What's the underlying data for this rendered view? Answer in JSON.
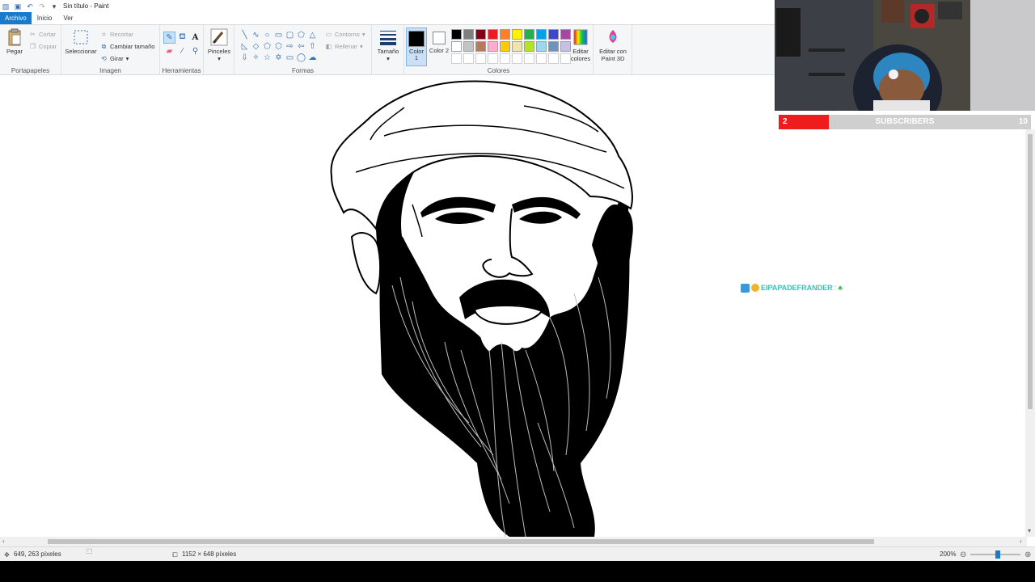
{
  "window": {
    "title": "Sin título - Paint"
  },
  "tabs": [
    "Archivo",
    "Inicio",
    "Ver"
  ],
  "ribbon": {
    "clipboard": {
      "label": "Portapapeles",
      "paste": "Pegar",
      "cut": "Cortar",
      "copy": "Copiar"
    },
    "image": {
      "label": "Imagen",
      "select": "Seleccionar",
      "crop": "Recortar",
      "resize": "Cambiar tamaño",
      "rotate": "Girar"
    },
    "tools": {
      "label": "Herramientas"
    },
    "brushes": {
      "label": "Pinceles"
    },
    "shapes": {
      "label": "Formas",
      "outline": "Contorno",
      "fill": "Rellenar"
    },
    "size": {
      "label": "Tamaño"
    },
    "colors": {
      "label": "Colores",
      "color1": "Color 1",
      "color2": "Color 2",
      "edit_colors": "Editar colores",
      "edit_paint3d": "Editar con Paint 3D",
      "color1_value": "#000000",
      "color2_value": "#ffffff",
      "palette": [
        "#000000",
        "#7f7f7f",
        "#880015",
        "#ed1c24",
        "#ff7f27",
        "#fff200",
        "#22b14c",
        "#00a2e8",
        "#3f48cc",
        "#a349a4",
        "#ffffff",
        "#c3c3c3",
        "#b97a57",
        "#ffaec9",
        "#ffc90e",
        "#efe4b0",
        "#b5e61d",
        "#99d9ea",
        "#7092be",
        "#c8bfe7",
        "#ffffff",
        "#ffffff",
        "#ffffff",
        "#ffffff",
        "#ffffff",
        "#ffffff",
        "#ffffff",
        "#ffffff",
        "#ffffff",
        "#ffffff"
      ]
    }
  },
  "overlay": {
    "subscribers": {
      "current": "2",
      "label": "SUBSCRIBERS",
      "goal": "10",
      "progress": 0.2
    },
    "chat": {
      "user": "EIPAPADEFRANDER",
      "separator": ":"
    }
  },
  "status": {
    "cursor_pos": "649, 263 píxeles",
    "canvas_size": "1152 × 648 píxeles",
    "zoom": "200%"
  }
}
